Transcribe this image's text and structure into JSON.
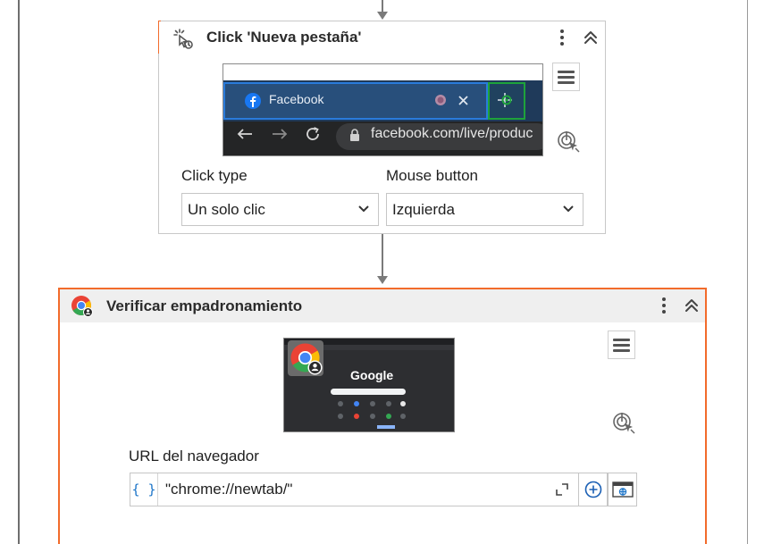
{
  "activities": [
    {
      "title": "Click 'Nueva pestaña'",
      "thumbnail": {
        "tab_label": "Facebook",
        "address_text": "facebook.com/live/produc"
      },
      "fields": [
        {
          "label": "Click type",
          "value": "Un solo clic"
        },
        {
          "label": "Mouse button",
          "value": "Izquierda"
        }
      ]
    },
    {
      "title": "Verificar empadronamiento",
      "thumbnail": {
        "logo_text": "Google"
      },
      "url_field": {
        "label": "URL del navegador",
        "value": "\"chrome://newtab/\"",
        "curly": "{ }"
      }
    }
  ],
  "icons": {
    "click": "click-activity-icon",
    "chrome": "chrome-icon",
    "kebab": "more-options-icon",
    "collapse": "collapse-icon",
    "menu": "menu-icon",
    "target": "indicate-target-icon",
    "expand": "expand-icon",
    "add": "plus-icon",
    "browser": "browser-icon"
  },
  "colors": {
    "accent": "#f26b2b",
    "facebook_blue": "#1877f2",
    "selection_green": "#1ea33b",
    "link_blue": "#1a73c8"
  }
}
